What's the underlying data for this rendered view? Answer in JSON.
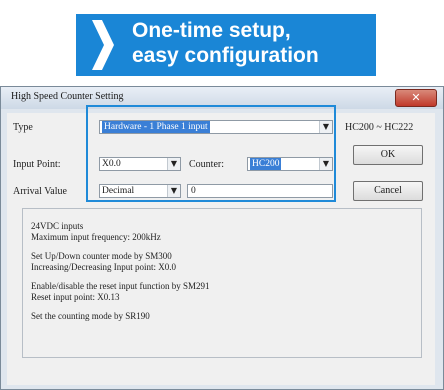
{
  "banner": {
    "line1": "One-time setup,",
    "line2": "easy configuration",
    "color": "#1a86d6",
    "icon": "chevron-right-icon"
  },
  "dialog": {
    "title": "High Speed Counter Setting",
    "close_glyph": "✕",
    "type_label": "Type",
    "type_value": "Hardware - 1 Phase 1 input",
    "type_range": "HC200 ~ HC222",
    "input_point_label": "Input Point:",
    "input_point_value": "X0.0",
    "counter_label": "Counter:",
    "counter_value": "HC200",
    "arrival_label": "Arrival Value",
    "arrival_mode": "Decimal",
    "arrival_value": "0",
    "ok_label": "OK",
    "cancel_label": "Cancel",
    "accent_color": "#1f8ad8",
    "info": [
      "24VDC inputs",
      "Maximum input frequency: 200kHz",
      "Set Up/Down counter mode by SM300",
      "Increasing/Decreasing Input point: X0.0",
      "Enable/disable the reset input function by SM291",
      "Reset input point: X0.13",
      "Set the counting mode by SR190"
    ]
  }
}
